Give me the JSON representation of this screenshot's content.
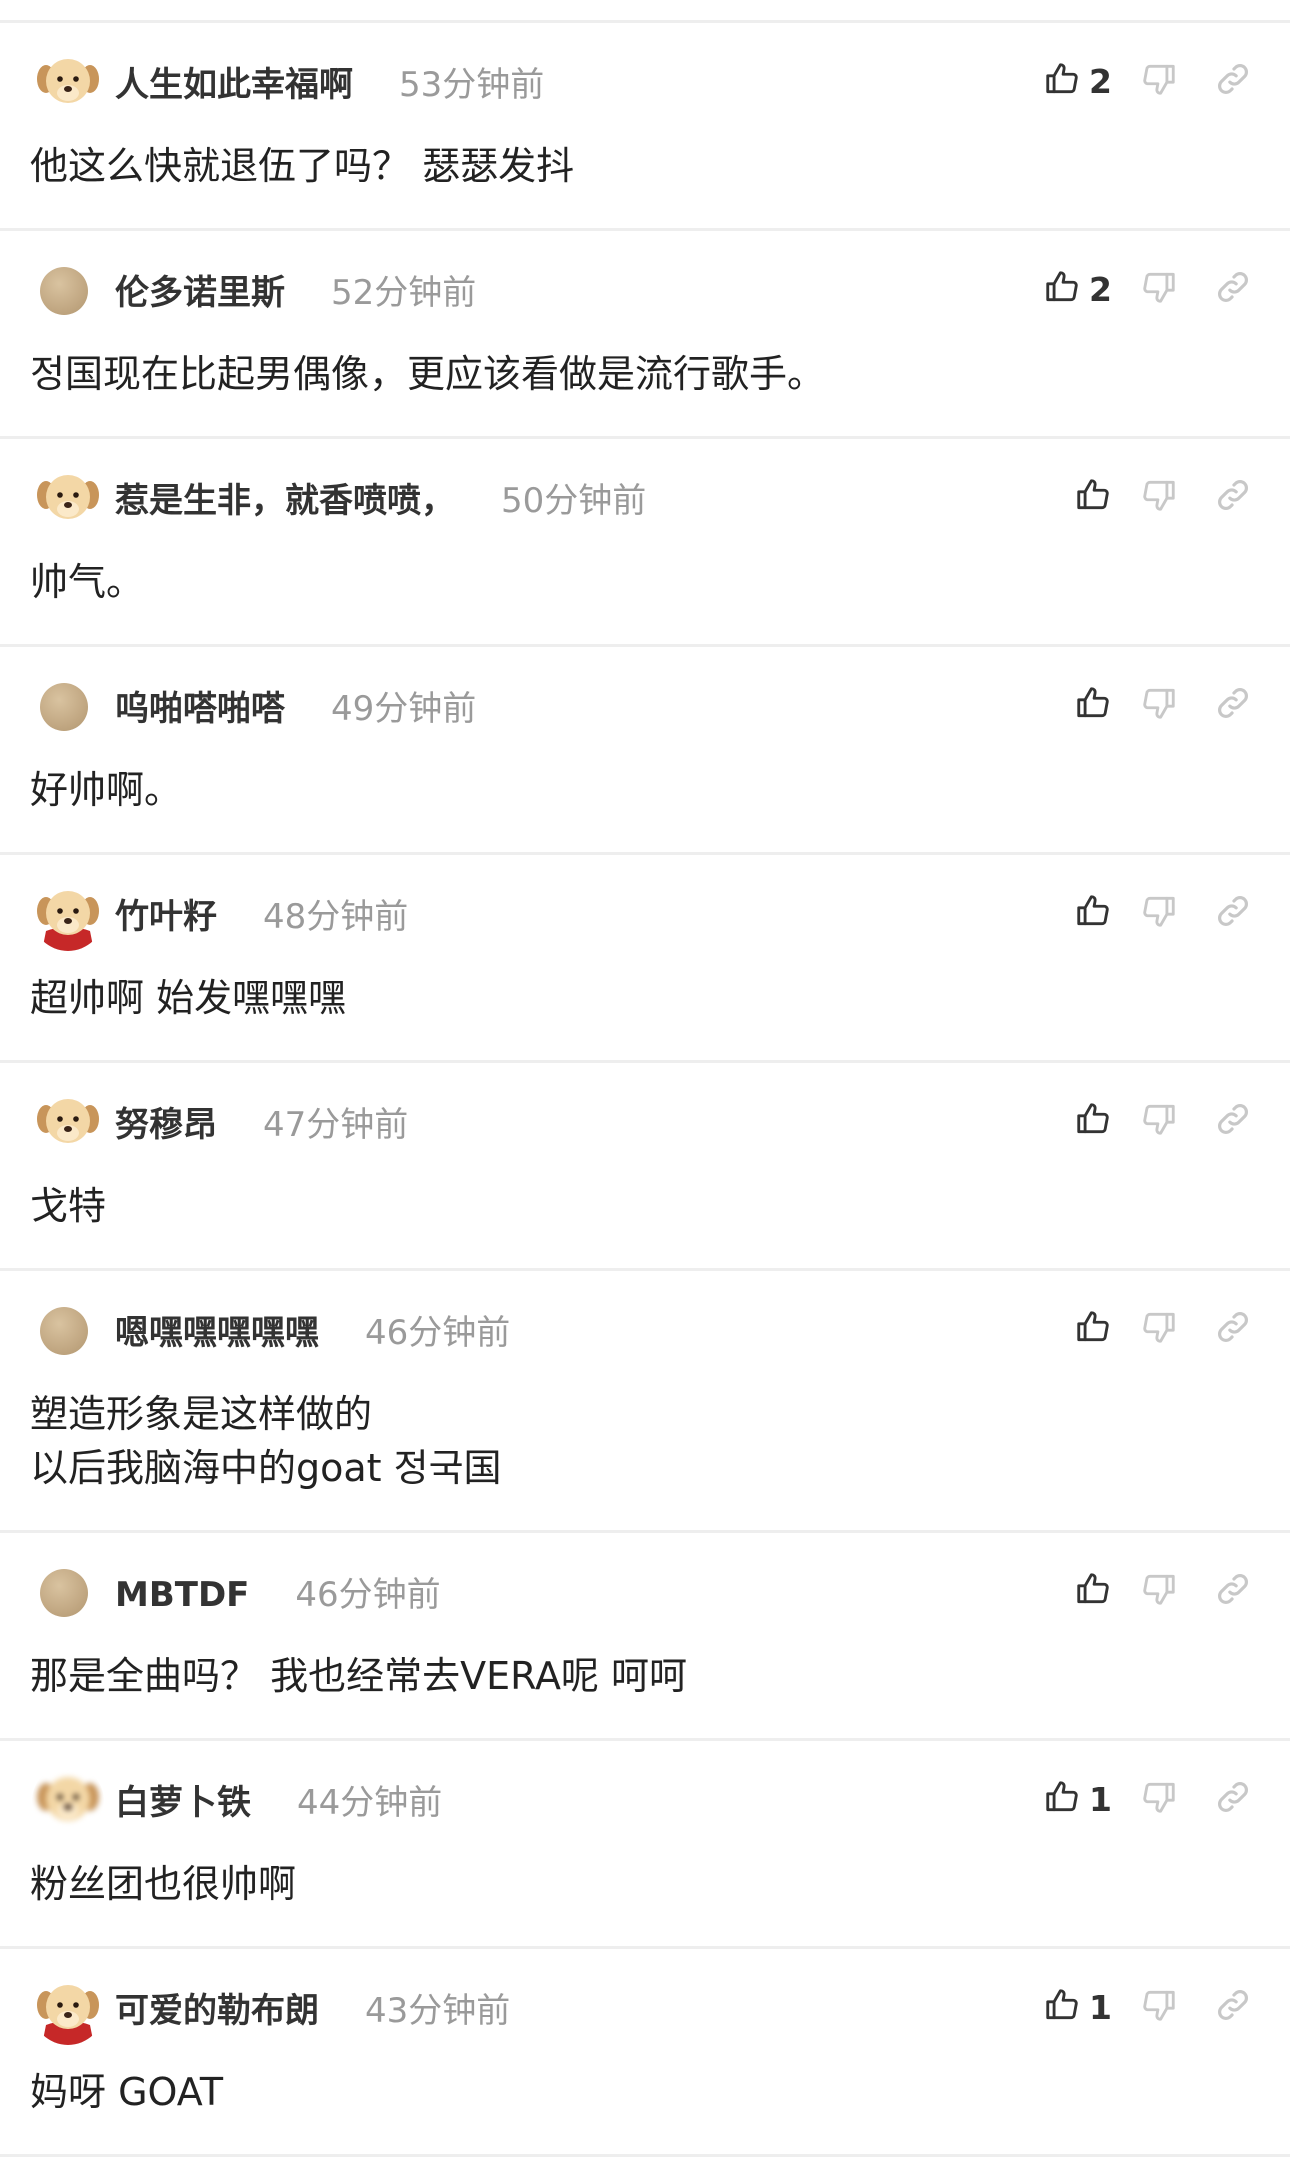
{
  "comments": [
    {
      "author": "人生如此幸福啊",
      "time": "53分钟前",
      "likes": "2",
      "text": "他这么快就退伍了吗？ 瑟瑟发抖",
      "avatar": "puppy"
    },
    {
      "author": "伦多诺里斯",
      "time": "52分钟前",
      "likes": "2",
      "text": "정国现在比起男偶像，更应该看做是流行歌手。",
      "avatar": "plain"
    },
    {
      "author": "惹是生非，就香喷喷，",
      "time": "50分钟前",
      "likes": "",
      "text": "帅气。",
      "avatar": "puppy"
    },
    {
      "author": "呜啪嗒啪嗒",
      "time": "49分钟前",
      "likes": "",
      "text": "好帅啊。",
      "avatar": "plain"
    },
    {
      "author": "竹叶籽",
      "time": "48分钟前",
      "likes": "",
      "text": "超帅啊 始发嘿嘿嘿",
      "avatar": "puppy-cape"
    },
    {
      "author": "努穆昂",
      "time": "47分钟前",
      "likes": "",
      "text": "戈特",
      "avatar": "puppy"
    },
    {
      "author": "嗯嘿嘿嘿嘿嘿",
      "time": "46分钟前",
      "likes": "",
      "text": "塑造形象是这样做的\n以后我脑海中的goat 정국国",
      "avatar": "plain"
    },
    {
      "author": "MBTDF",
      "time": "46分钟前",
      "likes": "",
      "text": "那是全曲吗？ 我也经常去VERA呢 呵呵",
      "avatar": "plain"
    },
    {
      "author": "白萝卜铁",
      "time": "44分钟前",
      "likes": "1",
      "text": "粉丝团也很帅啊",
      "avatar": "puppy-blur"
    },
    {
      "author": "可爱的勒布朗",
      "time": "43分钟前",
      "likes": "1",
      "text": "妈呀 GOAT",
      "avatar": "puppy-cape"
    }
  ],
  "colors": {
    "divider": "#eeeeee",
    "author": "#333333",
    "time": "#9a9a9a",
    "like_icon": "#333333",
    "dislike_icon": "#c8c8c8",
    "link_icon": "#c8c8c8"
  },
  "icons": {
    "like": "thumbs-up-icon",
    "dislike": "thumbs-down-icon",
    "link": "link-icon",
    "avatar": "puppy-avatar-icon"
  }
}
